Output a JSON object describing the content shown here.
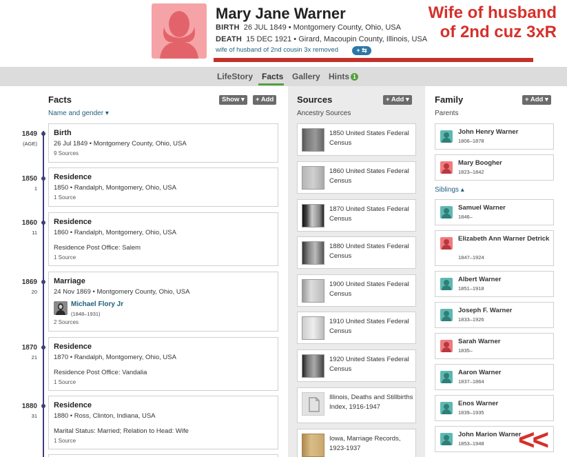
{
  "person": {
    "name": "Mary Jane Warner",
    "birth_label": "BIRTH",
    "birth_value": "26 JUL 1849 • Montgomery County, Ohio, USA",
    "death_label": "DEATH",
    "death_value": "15 DEC 1921 • Girard, Macoupin County, Illinois, USA",
    "relationship": "wife of husband of 2nd cousin 3x removed",
    "relationship_badge": "+ ⇆"
  },
  "annotation": {
    "line1": "Wife of husband",
    "line2": "of 2nd cuz 3xR",
    "arrows": "<<"
  },
  "tabs": [
    {
      "label": "LifeStory"
    },
    {
      "label": "Facts"
    },
    {
      "label": "Gallery"
    },
    {
      "label": "Hints"
    }
  ],
  "hints_count": "1",
  "facts": {
    "heading": "Facts",
    "show_button": "Show ▾",
    "add_button": "+ Add",
    "filter_link": "Name and gender ▾",
    "items": [
      {
        "year": "1849",
        "age": "(AGE)",
        "title": "Birth",
        "detail": "26 Jul 1849 • Montgomery County, Ohio, USA",
        "sources": "9 Sources"
      },
      {
        "year": "1850",
        "age": "1",
        "title": "Residence",
        "detail": "1850 • Randalph, Montgomery, Ohio, USA",
        "sources": "1 Source"
      },
      {
        "year": "1860",
        "age": "11",
        "title": "Residence",
        "detail": "1860 • Randalph, Montgomery, Ohio, USA",
        "extra": "Residence Post Office: Salem",
        "sources": "1 Source"
      },
      {
        "year": "1869",
        "age": "20",
        "title": "Marriage",
        "detail": "24 Nov 1869 • Montgomery County, Ohio, USA",
        "spouse_name": "Michael Flory Jr",
        "spouse_dates": "(1848–1931)",
        "sources": "2 Sources"
      },
      {
        "year": "1870",
        "age": "21",
        "title": "Residence",
        "detail": "1870 • Randalph, Montgomery, Ohio, USA",
        "extra": "Residence Post Office: Vandalia",
        "sources": "1 Source"
      },
      {
        "year": "1880",
        "age": "31",
        "title": "Residence",
        "detail": "1880 • Ross, Clinton, Indiana, USA",
        "extra": "Marital Status: Married; Relation to Head: Wife",
        "sources": "1 Source"
      }
    ]
  },
  "sources": {
    "heading": "Sources",
    "add_button": "+ Add ▾",
    "subheading": "Ancestry Sources",
    "items": [
      {
        "title": "1850 United States Federal Census"
      },
      {
        "title": "1860 United States Federal Census"
      },
      {
        "title": "1870 United States Federal Census"
      },
      {
        "title": "1880 United States Federal Census"
      },
      {
        "title": "1900 United States Federal Census"
      },
      {
        "title": "1910 United States Federal Census"
      },
      {
        "title": "1920 United States Federal Census"
      },
      {
        "title": "Illinois, Deaths and Stillbirths Index, 1916-1947"
      },
      {
        "title": "Iowa, Marriage Records, 1923-1937"
      }
    ]
  },
  "family": {
    "heading": "Family",
    "add_button": "+ Add ▾",
    "parents_label": "Parents",
    "siblings_label": "Siblings ▴",
    "parents": [
      {
        "name": "John Henry Warner",
        "dates": "1806–1878",
        "gender": "m"
      },
      {
        "name": "Mary Boogher",
        "dates": "1823–1842",
        "gender": "f"
      }
    ],
    "siblings": [
      {
        "name": "Samuel Warner",
        "dates": "1846–",
        "gender": "m"
      },
      {
        "name": "Elizabeth Ann Warner Detrick",
        "dates": "1847–1924",
        "gender": "f"
      },
      {
        "name": "Albert Warner",
        "dates": "1851–1918",
        "gender": "m"
      },
      {
        "name": "Joseph F. Warner",
        "dates": "1833–1926",
        "gender": "m"
      },
      {
        "name": "Sarah Warner",
        "dates": "1835–",
        "gender": "f"
      },
      {
        "name": "Aaron Warner",
        "dates": "1837–1864",
        "gender": "m"
      },
      {
        "name": "Enos Warner",
        "dates": "1839–1935",
        "gender": "m"
      },
      {
        "name": "John Marion Warner",
        "dates": "1853–1948",
        "gender": "m"
      }
    ]
  }
}
